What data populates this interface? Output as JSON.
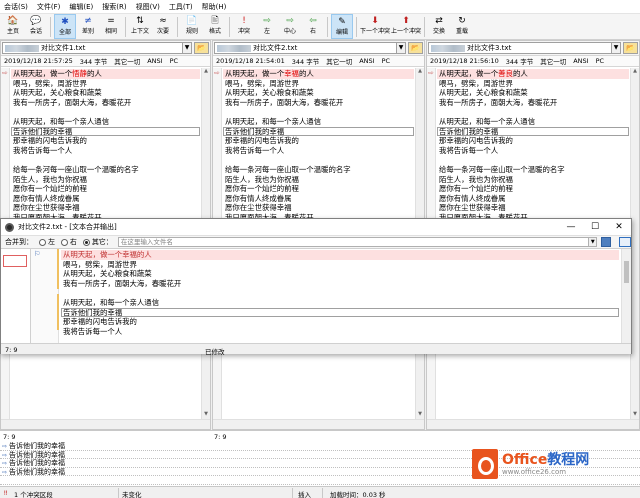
{
  "menu": [
    "会话(S)",
    "文件(F)",
    "编辑(E)",
    "搜索(R)",
    "视图(V)",
    "工具(T)",
    "帮助(H)"
  ],
  "toolbar": [
    {
      "label": "主页",
      "icon": "home-icon",
      "glyph": "🏠"
    },
    {
      "label": "会话",
      "icon": "session-icon",
      "glyph": "💬"
    },
    {
      "label": "全部",
      "icon": "all-icon",
      "glyph": "✱",
      "active": true
    },
    {
      "label": "差别",
      "icon": "diff-icon",
      "glyph": "≠"
    },
    {
      "label": "相同",
      "icon": "same-icon",
      "glyph": "="
    },
    {
      "label": "上下文",
      "icon": "context-icon",
      "glyph": "⇅"
    },
    {
      "label": "次要",
      "icon": "minor-icon",
      "glyph": "≈"
    },
    {
      "label": "规则",
      "icon": "rules-icon",
      "glyph": "📄"
    },
    {
      "label": "格式",
      "icon": "format-icon",
      "glyph": "🖹"
    },
    {
      "label": "冲突",
      "icon": "conflict-icon",
      "glyph": "!"
    },
    {
      "label": "左",
      "icon": "left-icon",
      "glyph": "⇨"
    },
    {
      "label": "中心",
      "icon": "center-icon",
      "glyph": "⇨"
    },
    {
      "label": "右",
      "icon": "right-icon",
      "glyph": "⇦"
    },
    {
      "label": "编辑",
      "icon": "edit-icon",
      "glyph": "✎",
      "active": true
    },
    {
      "label": "下一个冲突",
      "icon": "next-conflict-icon",
      "glyph": "⬇"
    },
    {
      "label": "上一个冲突",
      "icon": "prev-conflict-icon",
      "glyph": "⬆"
    },
    {
      "label": "交换",
      "icon": "swap-icon",
      "glyph": "⇄"
    },
    {
      "label": "重载",
      "icon": "reload-icon",
      "glyph": "↻"
    }
  ],
  "panes": [
    {
      "filename": "对比文件1.txt",
      "date": "2019/12/18 21:57:25",
      "bytes": "344 字节",
      "other": "其它一切",
      "encoding": "ANSI",
      "lineend": "PC",
      "lines": [
        {
          "pre": "从明天起，做一个",
          "hl": "悟静",
          "post": "的人",
          "diff": true
        },
        {
          "pre": "喂马，劈柴，周游世界"
        },
        {
          "pre": "从明天起，关心粮食和蔬菜"
        },
        {
          "pre": "我有一所房子，面朝大海，春暖花开"
        },
        {
          "pre": ""
        },
        {
          "pre": "从明天起，和每一个亲人通信"
        },
        {
          "pre": "告诉他们我的幸福",
          "boxed": true
        },
        {
          "pre": "那幸福的闪电告诉我的"
        },
        {
          "pre": "我将告诉每一个人"
        },
        {
          "pre": ""
        },
        {
          "pre": "给每一条河每一座山取一个温暖的名字"
        },
        {
          "pre": "陌生人，我也为你祝福"
        },
        {
          "pre": "愿你有一个灿烂的前程"
        },
        {
          "pre": "愿你有情人终成眷属"
        },
        {
          "pre": "愿你在尘世获得幸福"
        },
        {
          "pre": "我只愿面朝大海，春暖花开"
        }
      ]
    },
    {
      "filename": "对比文件2.txt",
      "date": "2019/12/18 21:54:01",
      "bytes": "344 字节",
      "other": "其它一切",
      "encoding": "ANSI",
      "lineend": "PC",
      "lines": [
        {
          "pre": "从明天起，做一个",
          "hl": "幸福",
          "post": "的人",
          "diff": true
        },
        {
          "pre": "喂马，劈柴，周游世界"
        },
        {
          "pre": "从明天起，关心粮食和蔬菜"
        },
        {
          "pre": "我有一所房子，面朝大海，春暖花开"
        },
        {
          "pre": ""
        },
        {
          "pre": "从明天起，和每一个亲人通信"
        },
        {
          "pre": "告诉他们我的幸福",
          "boxed": true
        },
        {
          "pre": "那幸福的闪电告诉我的"
        },
        {
          "pre": "我将告诉每一个人"
        },
        {
          "pre": ""
        },
        {
          "pre": "给每一条河每一座山取一个温暖的名字"
        },
        {
          "pre": "陌生人，我也为你祝福"
        },
        {
          "pre": "愿你有一个灿烂的前程"
        },
        {
          "pre": "愿你有情人终成眷属"
        },
        {
          "pre": "愿你在尘世获得幸福"
        },
        {
          "pre": "我只愿面朝大海，春暖花开"
        }
      ]
    },
    {
      "filename": "对比文件3.txt",
      "date": "2019/12/18 21:56:10",
      "bytes": "344 字节",
      "other": "其它一切",
      "encoding": "ANSI",
      "lineend": "PC",
      "lines": [
        {
          "pre": "从明天起，做一个",
          "hl": "善良",
          "post": "的人",
          "diff": true
        },
        {
          "pre": "喂马，劈柴，周游世界"
        },
        {
          "pre": "从明天起，关心粮食和蔬菜"
        },
        {
          "pre": "我有一所房子，面朝大海，春暖花开"
        },
        {
          "pre": ""
        },
        {
          "pre": "从明天起，和每一个亲人通信"
        },
        {
          "pre": "告诉他们我的幸福",
          "boxed": true
        },
        {
          "pre": "那幸福的闪电告诉我的"
        },
        {
          "pre": "我将告诉每一个人"
        },
        {
          "pre": ""
        },
        {
          "pre": "给每一条河每一座山取一个温暖的名字"
        },
        {
          "pre": "陌生人，我也为你祝福"
        },
        {
          "pre": "愿你有一个灿烂的前程"
        },
        {
          "pre": "愿你有情人终成眷属"
        },
        {
          "pre": "愿你在尘世获得幸福"
        },
        {
          "pre": "我只愿面朝大海，春暖花开"
        }
      ]
    }
  ],
  "merge_window": {
    "title": "对比文件2.txt - [文本合并输出]",
    "merge_to_label": "合并到：",
    "options": [
      {
        "label": "左",
        "checked": false
      },
      {
        "label": "右",
        "checked": false
      },
      {
        "label": "其它：",
        "checked": true
      }
    ],
    "file_placeholder": "在这里输入文件名",
    "lines": [
      {
        "text": "从明天起，做一个幸福的人",
        "diff": true
      },
      {
        "text": "喂马，劈柴，周游世界"
      },
      {
        "text": "从明天起，关心粮食和蔬菜"
      },
      {
        "text": "我有一所房子，面朝大海，春暖花开"
      },
      {
        "text": ""
      },
      {
        "text": "从明天起，和每一个亲人通信"
      },
      {
        "text": "告诉他们我的幸福",
        "boxed": true
      },
      {
        "text": "那幸福的闪电告诉我的"
      },
      {
        "text": "我将告诉每一个人"
      },
      {
        "text": ""
      },
      {
        "text": "给每一条河每一座山取一个温暖的名字"
      }
    ],
    "status_pos": "7: 9",
    "status_text": "已修改"
  },
  "bottom": {
    "pos_left": "7: 9",
    "pos_mid": "7: 9",
    "lines": [
      "告诉他们我的幸福",
      "告诉他们我的幸福",
      "告诉他们我的幸福",
      "告诉他们我的幸福"
    ]
  },
  "statusbar": {
    "conflicts": "1 个冲突区段",
    "changed": "未变化",
    "mode": "插入",
    "load_time": "加载时间：0.03 秒"
  },
  "watermark": {
    "brand_a": "Office",
    "brand_b": "教程网",
    "url": "www.office26.com"
  },
  "colors": {
    "diff_bg": "#fde0e0",
    "diff_text": "#e00000",
    "active_tool": "#cce4f7",
    "brand_orange": "#e8541e",
    "brand_blue": "#2b66c7"
  }
}
